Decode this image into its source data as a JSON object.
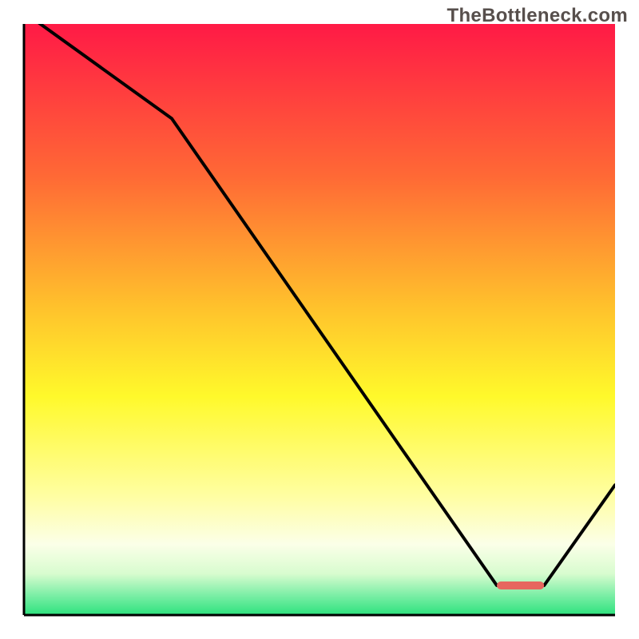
{
  "watermark": "TheBottleneck.com",
  "colors": {
    "red_top": "#ff1a46",
    "orange": "#ffa42e",
    "yellow": "#fff92b",
    "pale_yellow": "#fffdd0",
    "green": "#2de27d",
    "line": "#000000",
    "marker": "#e7665f"
  },
  "chart_data": {
    "type": "line",
    "title": "",
    "xlabel": "",
    "ylabel": "",
    "xlim": [
      0,
      100
    ],
    "ylim": [
      0,
      100
    ],
    "x": [
      0,
      25,
      80,
      88,
      100
    ],
    "values": [
      102,
      84,
      5,
      5,
      22
    ],
    "marker_band": {
      "x0": 80,
      "x1": 88,
      "y": 5
    },
    "grid": false
  }
}
